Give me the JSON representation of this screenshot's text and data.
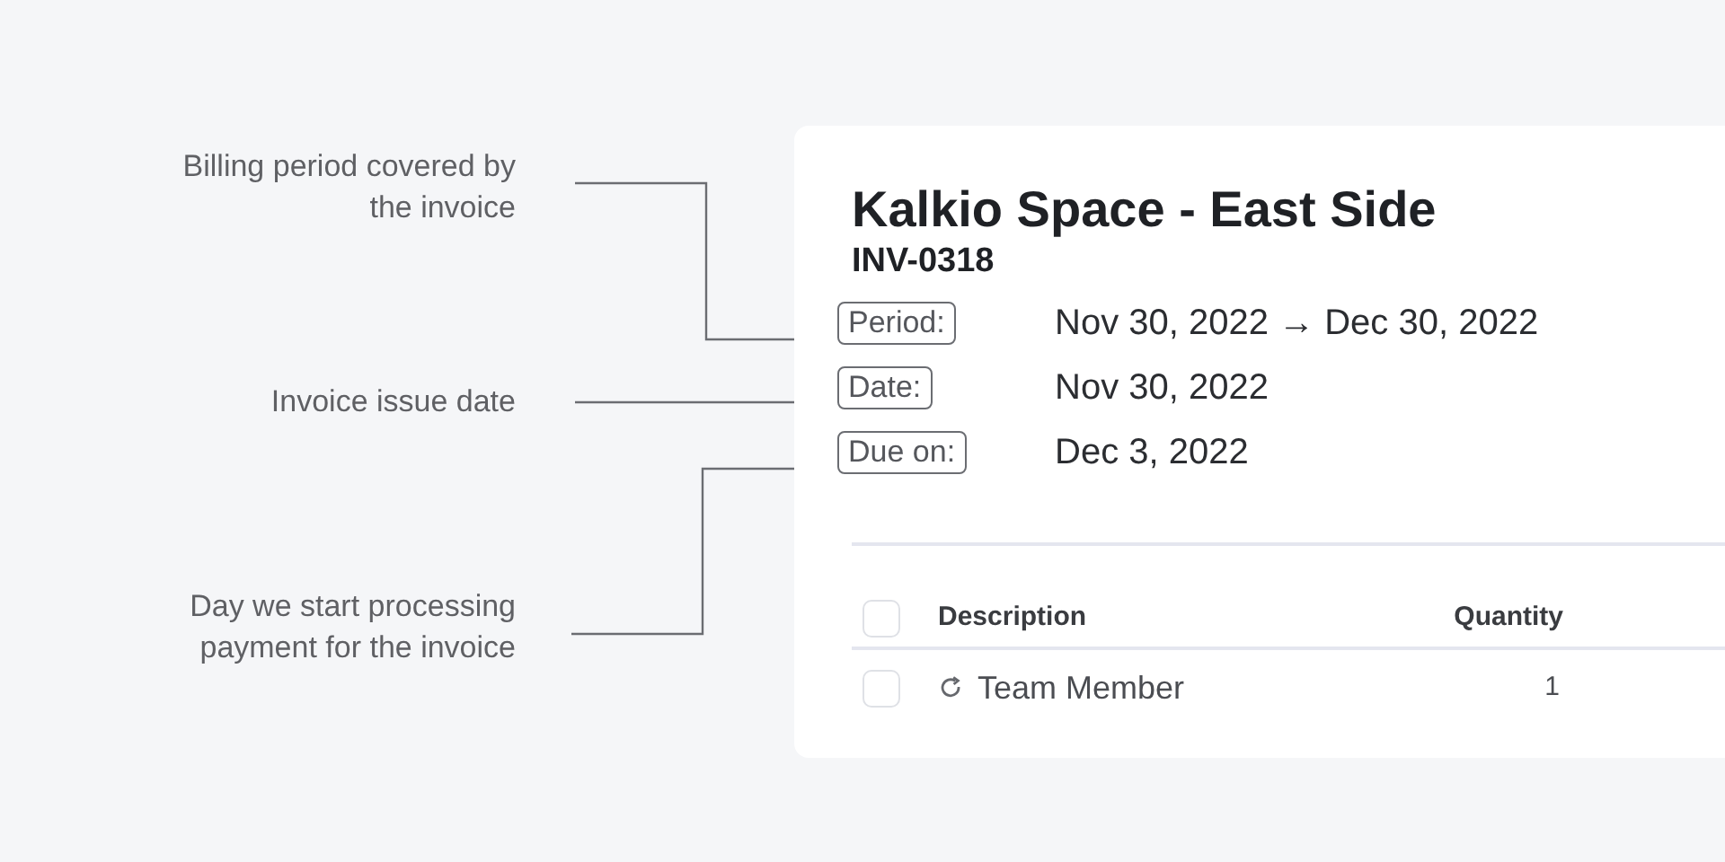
{
  "annotations": [
    {
      "text": "Billing period covered by the invoice"
    },
    {
      "text": "Invoice issue date"
    },
    {
      "text": "Day we start processing payment for the invoice"
    }
  ],
  "invoice": {
    "title": "Kalkio Space - East Side",
    "number": "INV-0318",
    "fields": [
      {
        "label": "Period:",
        "value": "Nov 30, 2022 → Dec 30, 2022"
      },
      {
        "label": "Date:",
        "value": "Nov 30, 2022"
      },
      {
        "label": "Due on:",
        "value": "Dec 3, 2022"
      }
    ]
  },
  "table": {
    "select_all_checked": false,
    "columns": [
      "Description",
      "Quantity"
    ],
    "rows": [
      {
        "checked": false,
        "recurring": true,
        "description": "Team Member",
        "quantity": "1"
      }
    ]
  }
}
